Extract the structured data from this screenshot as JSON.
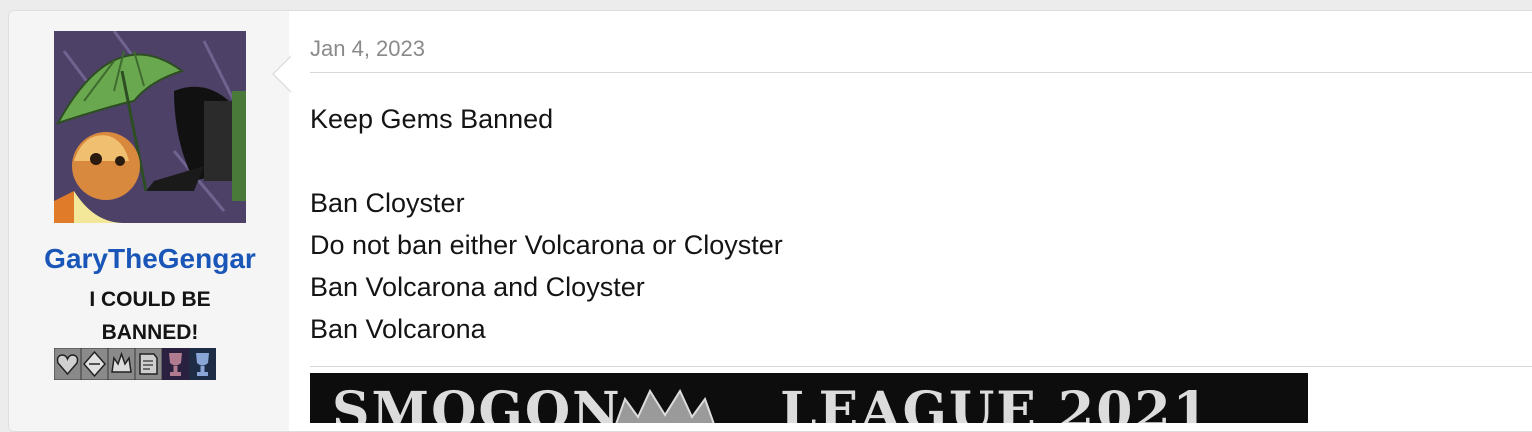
{
  "user": {
    "username": "GaryTheGengar",
    "title": "I COULD BE BANNED!",
    "avatar_icon": "avatar-illustration",
    "badges": [
      "heart-badge-icon",
      "diamond-badge-icon",
      "crown-badge-icon",
      "note-badge-icon",
      "trophy-badge-icon",
      "trophy-badge-icon"
    ],
    "colors": {
      "username": "#1a56b8"
    }
  },
  "post": {
    "date": "Jan 4, 2023",
    "lines": [
      "Keep Gems Banned",
      "",
      "Ban Cloyster",
      "Do not ban either Volcarona or Cloyster",
      "Ban Volcarona and Cloyster",
      "Ban Volcarona"
    ]
  },
  "signature": {
    "banner_left": "SMOGON",
    "banner_right": "LEAGUE 2021"
  }
}
